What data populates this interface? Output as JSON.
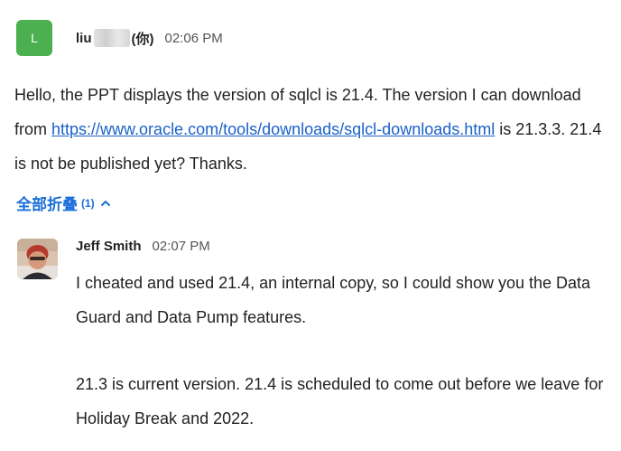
{
  "message": {
    "avatar_initial": "L",
    "sender_prefix": "liu",
    "sender_suffix": "(你)",
    "time": "02:06 PM",
    "text_before": "Hello, the PPT displays the version of sqlcl is 21.4. The version I can download from ",
    "link": "https://www.oracle.com/tools/downloads/sqlcl-downloads.html",
    "text_after": " is 21.3.3. 21.4 is not be published yet? Thanks."
  },
  "collapse": {
    "label": "全部折叠",
    "count": "(1)",
    "icon": "chevron-up-icon"
  },
  "reply": {
    "name": "Jeff Smith",
    "time": "02:07 PM",
    "para1": "I cheated and used 21.4, an internal copy, so I could show you the Data Guard and Data Pump features.",
    "para2": "21.3 is current version. 21.4 is scheduled to come out before we leave for Holiday Break and 2022."
  },
  "colors": {
    "avatar_green": "#4caf50",
    "link_blue": "#1a61c9",
    "collapse_blue": "#1a6fd8"
  }
}
